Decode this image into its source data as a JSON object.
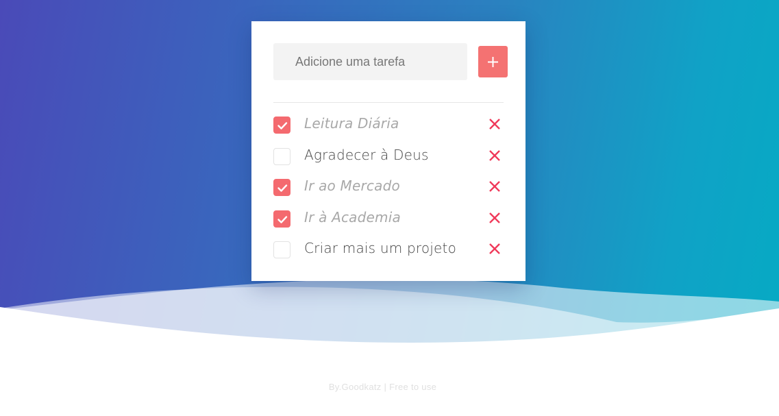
{
  "input": {
    "placeholder": "Adicione uma tarefa",
    "value": ""
  },
  "add_button": {
    "icon": "plus-icon"
  },
  "tasks": [
    {
      "label": "Leitura Diária",
      "done": true
    },
    {
      "label": "Agradecer à Deus",
      "done": false
    },
    {
      "label": "Ir ao Mercado",
      "done": true
    },
    {
      "label": "Ir à Academia",
      "done": true
    },
    {
      "label": "Criar mais um projeto",
      "done": false
    }
  ],
  "footer": {
    "author": "By.Goodkatz",
    "separator": "|",
    "license": "Free to use"
  },
  "colors": {
    "accent": "#f46a6f",
    "delete": "#f0395a",
    "gradient_start": "#4a4ab8",
    "gradient_end": "#06aac4"
  }
}
